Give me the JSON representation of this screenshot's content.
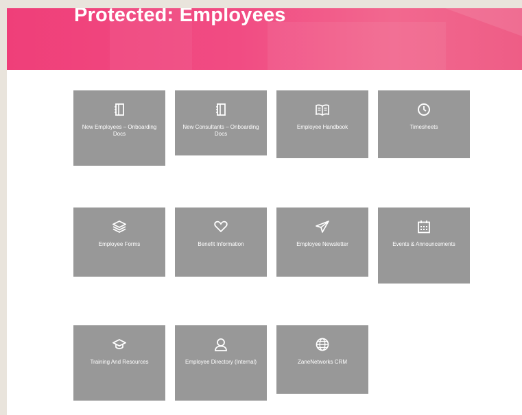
{
  "page": {
    "title": "Protected: Employees"
  },
  "tiles": [
    {
      "label": "New Employees – Onboarding Docs",
      "icon": "notebook-icon"
    },
    {
      "label": "New Consultants – Onboarding Docs",
      "icon": "notebook-icon"
    },
    {
      "label": "Employee Handbook",
      "icon": "open-book-icon"
    },
    {
      "label": "Timesheets",
      "icon": "clock-icon"
    },
    {
      "label": "Employee Forms",
      "icon": "layers-icon"
    },
    {
      "label": "Benefit Information",
      "icon": "heart-icon"
    },
    {
      "label": "Employee Newsletter",
      "icon": "paper-plane-icon"
    },
    {
      "label": "Events & Announcements",
      "icon": "calendar-icon"
    },
    {
      "label": "Training And Resources",
      "icon": "graduation-cap-icon"
    },
    {
      "label": "Employee Directory (Internal)",
      "icon": "user-icon"
    },
    {
      "label": "ZaneNetworks CRM",
      "icon": "globe-icon"
    }
  ],
  "colors": {
    "hero": "#ef3f79",
    "tile": "#989898",
    "tile_text": "#ffffff"
  }
}
